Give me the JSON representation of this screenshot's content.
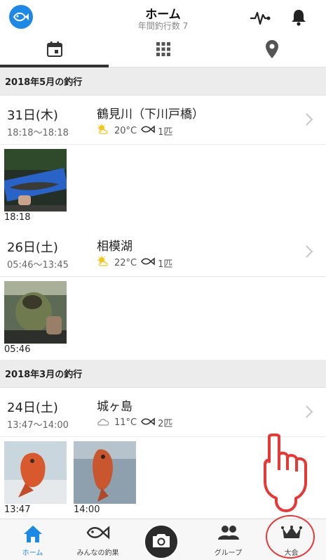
{
  "header": {
    "title": "ホーム",
    "subtitle": "年間釣行数 7",
    "logo_icon": "fish-logo-icon",
    "activity_icon": "activity-icon",
    "bell_icon": "bell-icon"
  },
  "tabs": [
    {
      "icon": "calendar-icon",
      "active": true
    },
    {
      "icon": "grid-icon",
      "active": false
    },
    {
      "icon": "location-pin-icon",
      "active": false
    }
  ],
  "sections": [
    {
      "title": "2018年5月の釣行",
      "trips": [
        {
          "date": "31日(木)",
          "time": "18:18〜18:18",
          "place": "鶴見川（下川戸橋）",
          "weather": "partly-sunny-icon",
          "temp": "20°C",
          "count": "1匹",
          "photos": [
            {
              "time": "18:18"
            }
          ]
        },
        {
          "date": "26日(土)",
          "time": "05:46〜13:45",
          "place": "相模湖",
          "weather": "partly-sunny-icon",
          "temp": "22°C",
          "count": "1匹",
          "photos": [
            {
              "time": "05:46"
            }
          ]
        }
      ]
    },
    {
      "title": "2018年3月の釣行",
      "trips": [
        {
          "date": "24日(土)",
          "time": "13:47〜14:00",
          "place": "城ヶ島",
          "weather": "cloudy-icon",
          "temp": "11°C",
          "count": "2匹",
          "photos": [
            {
              "time": "13:47"
            },
            {
              "time": "14:00"
            }
          ]
        }
      ]
    }
  ],
  "bottom_nav": [
    {
      "label": "ホーム",
      "icon": "home-icon",
      "active": true
    },
    {
      "label": "みんなの釣果",
      "icon": "fish-icon",
      "active": false
    },
    {
      "label": "",
      "icon": "camera-icon",
      "active": false
    },
    {
      "label": "グループ",
      "icon": "group-icon",
      "active": false
    },
    {
      "label": "大会",
      "icon": "crown-icon",
      "active": false
    }
  ],
  "colors": {
    "accent": "#1e88e5",
    "annotation": "#e53935",
    "section_bg": "#ececec"
  }
}
